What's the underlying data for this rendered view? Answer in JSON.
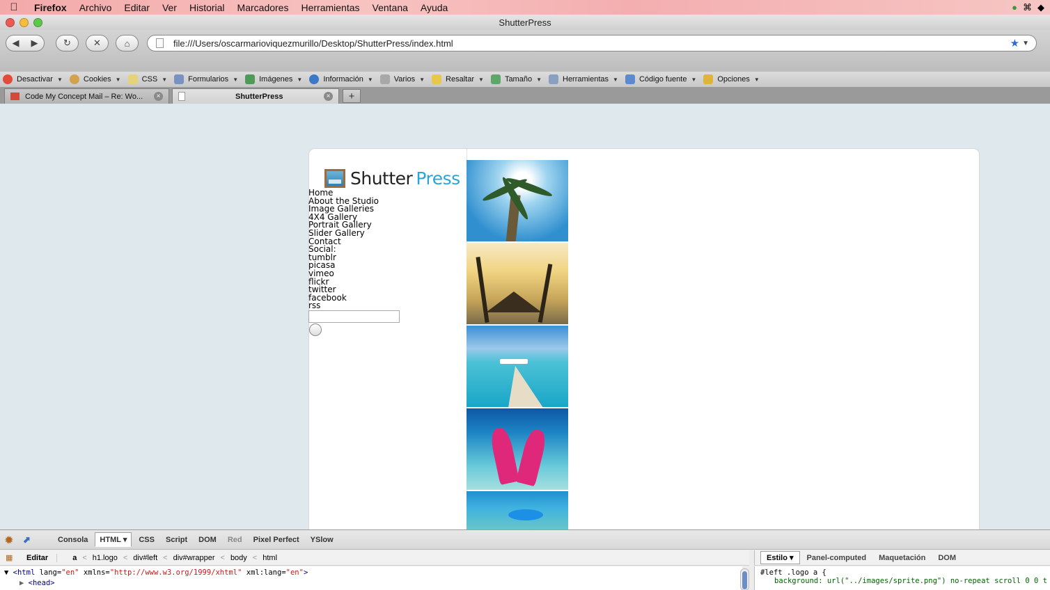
{
  "menubar": {
    "app": "Firefox",
    "items": [
      "Archivo",
      "Editar",
      "Ver",
      "Historial",
      "Marcadores",
      "Herramientas",
      "Ventana",
      "Ayuda"
    ]
  },
  "window": {
    "title": "ShutterPress"
  },
  "navbar": {
    "url": "file:///Users/oscarmarioviquezmurillo/Desktop/ShutterPress/index.html"
  },
  "devtoolbar": {
    "items": [
      "Desactivar",
      "Cookies",
      "CSS",
      "Formularios",
      "Imágenes",
      "Información",
      "Varios",
      "Resaltar",
      "Tamaño",
      "Herramientas",
      "Código fuente",
      "Opciones"
    ]
  },
  "tabs": [
    {
      "label": "Code My Concept Mail – Re: Wo..."
    },
    {
      "label": "ShutterPress"
    }
  ],
  "page": {
    "logo_part1": "Shutter",
    "logo_part2": "Press",
    "nav": [
      "Home",
      "About the Studio",
      "Image Galleries",
      "4X4 Gallery",
      "Portrait Gallery",
      "Slider Gallery",
      "Contact",
      "Social:",
      "tumblr",
      "picasa",
      "vimeo",
      "flickr",
      "twitter",
      "facebook",
      "rss"
    ]
  },
  "firebug": {
    "tabs": [
      "Consola",
      "HTML",
      "CSS",
      "Script",
      "DOM",
      "Red",
      "Pixel Perfect",
      "YSlow"
    ],
    "edit": "Editar",
    "crumbs": [
      "a",
      "h1.logo",
      "div#left",
      "div#wrapper",
      "body",
      "html"
    ],
    "side_tabs": [
      "Estilo",
      "Panel-computed",
      "Maquetación",
      "DOM"
    ],
    "html_line1_tag": "<html",
    "html_line1_attr1": " lang=",
    "html_line1_val1": "\"en\"",
    "html_line1_attr2": " xmlns=",
    "html_line1_val2": "\"http://www.w3.org/1999/xhtml\"",
    "html_line1_attr3": " xml:lang=",
    "html_line1_val3": "\"en\"",
    "html_line1_end": ">",
    "html_line2": "<head>",
    "css_selector": "#left .logo a {",
    "css_prop": "background: url(\"../images/sprite.png\") no-repeat scroll 0 0 t"
  }
}
